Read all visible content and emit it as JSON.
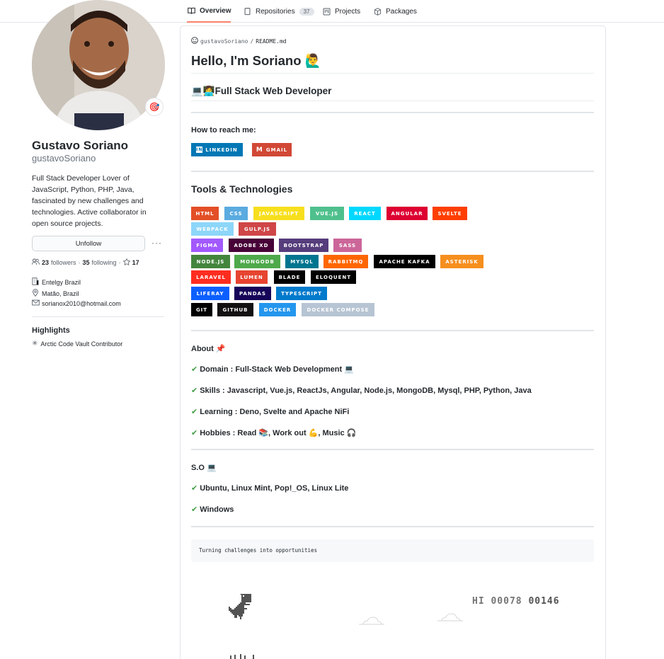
{
  "tabs": [
    {
      "label": "Overview",
      "icon": "book-icon"
    },
    {
      "label": "Repositories",
      "icon": "repo-icon",
      "count": "37"
    },
    {
      "label": "Projects",
      "icon": "project-icon"
    },
    {
      "label": "Packages",
      "icon": "package-icon"
    }
  ],
  "profile": {
    "name": "Gustavo Soriano",
    "login": "gustavoSoriano",
    "bio": "Full Stack Developer Lover of JavaScript, Python, PHP, Java, fascinated by new challenges and technologies. Active collaborator in open source projects.",
    "unfollow_label": "Unfollow",
    "followers_count": "23",
    "followers_label": "followers",
    "following_count": "35",
    "following_label": "following",
    "stars_count": "17",
    "company": "Entelgy Brazil",
    "location": "Matão, Brazil",
    "email": "sorianox2010@hotmail.com",
    "highlights_title": "Highlights",
    "highlight_item": "Arctic Code Vault Contributor"
  },
  "readme": {
    "owner": "gustavoSoriano",
    "file": "README.md",
    "title": "Hello, I'm Soriano 🙋‍♂️",
    "subtitle": "💻👩‍💻Full Stack Web Developer",
    "reach_title": "How to reach me:",
    "contact_badges": [
      {
        "label": "LINKEDIN",
        "color": "#0077b5"
      },
      {
        "label": "GMAIL",
        "color": "#d14836"
      }
    ],
    "tools_title": "Tools & Technologies",
    "tech_badges": [
      [
        {
          "label": "HTML",
          "color": "#e34f26"
        },
        {
          "label": "CSS",
          "color": "#1572b6",
          "bg": "#5aabe0"
        },
        {
          "label": "JAVASCRIPT",
          "color": "#f7df1e"
        },
        {
          "label": "VUE.JS",
          "color": "#4fc08d"
        },
        {
          "label": "REACT",
          "color": "#00d8ff"
        },
        {
          "label": "ANGULAR",
          "color": "#dd0031"
        },
        {
          "label": "SVELTE",
          "color": "#ff3e00"
        }
      ],
      [
        {
          "label": "WEBPACK",
          "color": "#8dd6f9"
        },
        {
          "label": "GULP.JS",
          "color": "#cf4647"
        }
      ],
      [
        {
          "label": "FIGMA",
          "color": "#a259ff"
        },
        {
          "label": "ADOBE XD",
          "color": "#470137"
        },
        {
          "label": "BOOTSTRAP",
          "color": "#563d7c"
        },
        {
          "label": "SASS",
          "color": "#cc6699"
        }
      ],
      [
        {
          "label": "NODE.JS",
          "color": "#43853d"
        },
        {
          "label": "MONGODB",
          "color": "#4ea94b"
        },
        {
          "label": "MYSQL",
          "color": "#00758f"
        },
        {
          "label": "RABBITMQ",
          "color": "#ff6600"
        },
        {
          "label": "APACHE KAFKA",
          "color": "#000000"
        },
        {
          "label": "ASTERISK",
          "color": "#f68f1e"
        }
      ],
      [
        {
          "label": "LARAVEL",
          "color": "#ff2d20"
        },
        {
          "label": "LUMEN",
          "color": "#e74430"
        },
        {
          "label": "BLADE",
          "color": "#000000"
        },
        {
          "label": "ELOQUENT",
          "color": "#000000"
        }
      ],
      [
        {
          "label": "LIFERAY",
          "color": "#0b5fff"
        },
        {
          "label": "PANDAS",
          "color": "#150458"
        },
        {
          "label": "TYPESCRIPT",
          "color": "#007acc"
        }
      ],
      [
        {
          "label": "GIT",
          "color": "#000000"
        },
        {
          "label": "GITHUB",
          "color": "#121011"
        },
        {
          "label": "DOCKER",
          "color": "#0db7ed"
        },
        {
          "label": "DOCKER COMPOSE",
          "color": "#b7c4d3"
        }
      ]
    ],
    "about_title": "About 📌",
    "about_lines": [
      "Domain : Full-Stack Web Development 💻",
      "Skills : Javascript, Vue.js, ReactJs, Angular, Node.js, MongoDB, Mysql, PHP, Python, Java",
      "Learning : Deno, Svelte and Apache NiFi",
      "Hobbies : Read 📚, Work out 💪, Music 🎧"
    ],
    "so_title": "S.O 💻",
    "so_lines": [
      "Ubuntu, Linux Mint, Pop!_OS, Linux Lite",
      "Windows"
    ],
    "quote": "Turning challenges into opportunities",
    "game_hi_label": "HI",
    "game_hi_score": "00078",
    "game_score": "00146"
  }
}
